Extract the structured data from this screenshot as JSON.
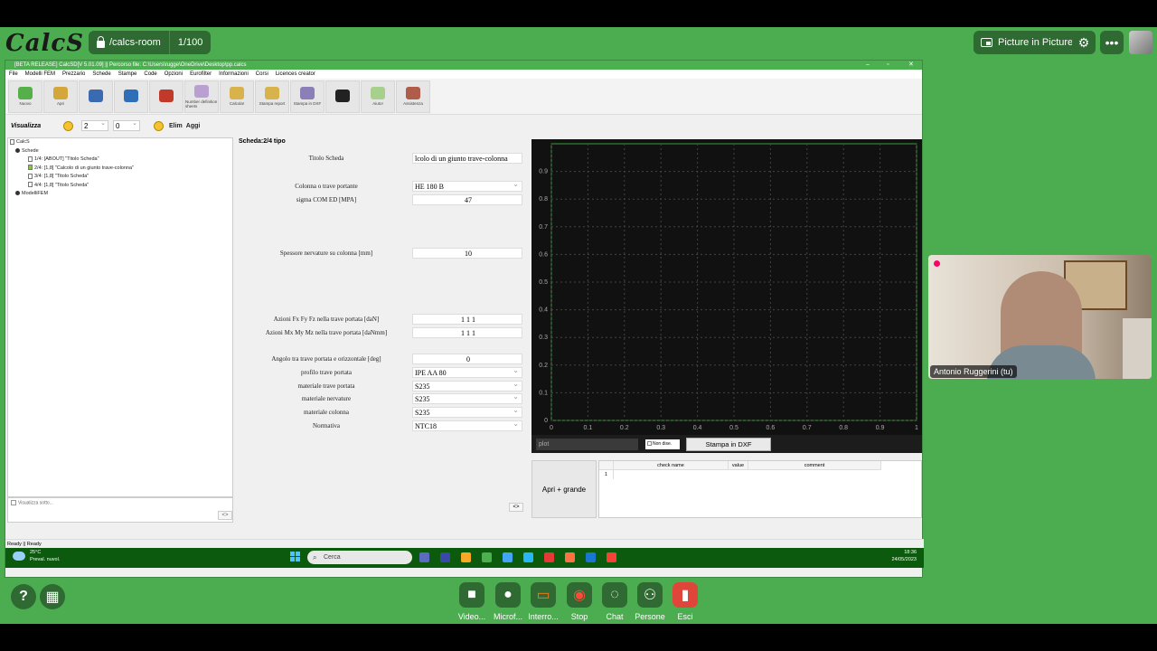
{
  "zoom": {
    "brand": "CalcS",
    "room": "/calcs-room",
    "page_counter": "1/100",
    "pip_label": "Picture in Picture",
    "participant_name": "Antonio Ruggerini (tu)",
    "bottom": [
      {
        "label": "Video..."
      },
      {
        "label": "Microf..."
      },
      {
        "label": "Interro..."
      },
      {
        "label": "Stop"
      },
      {
        "label": "Chat"
      },
      {
        "label": "Persone"
      },
      {
        "label": "Esci"
      }
    ]
  },
  "app": {
    "title": "[BETA RELEASE] CalcSD[V 5.01.09] || Percorso file: C:\\Users\\rugge\\OneDrive\\Desktop\\pp.calcs",
    "menu": [
      "File",
      "Modelli FEM",
      "Prezzario",
      "Schede",
      "Stampe",
      "Code",
      "Opzioni",
      "Eurofilter",
      "Informazioni",
      "Corsi",
      "Licences creator"
    ],
    "toolbar": [
      {
        "label": "Nuovo",
        "color": "#55b04a"
      },
      {
        "label": "Apri",
        "color": "#d4a73c"
      },
      {
        "label": "",
        "color": "#3a6ab0"
      },
      {
        "label": "",
        "color": "#2e6fb8"
      },
      {
        "label": "",
        "color": "#c0392b"
      },
      {
        "label": "Number definition sheets",
        "color": "#b9a0d0"
      },
      {
        "label": "Calcola!",
        "color": "#d8b24a"
      },
      {
        "label": "Stampa report",
        "color": "#d8b24a"
      },
      {
        "label": "Stampa in DXF",
        "color": "#8c7fb8"
      },
      {
        "label": "",
        "color": "#222"
      },
      {
        "label": "Aiuto!",
        "color": "#a8d08d"
      },
      {
        "label": "Assistenza",
        "color": "#b05c4a"
      }
    ],
    "viz": {
      "label": "Visualizza",
      "sel1": "2",
      "sel2": "0",
      "elim": "Elim",
      "aggi": "Aggi"
    },
    "tree": {
      "root": "CalcS",
      "schede": "Schede",
      "items": [
        "1/4: [ABOUT] \"Titolo Scheda\"",
        "2/4: [1,8] \"Calcolo di un giunto trave-colonna\"",
        "3/4: [1,8] \"Titolo Scheda\"",
        "4/4: [1,8] \"Titolo Scheda\""
      ],
      "fem": "ModelliFEM",
      "footer": "Visualizza sotto..."
    },
    "form": {
      "header": "Scheda:2/4 tipo",
      "titolo_label": "Titolo Scheda",
      "titolo_value": "lcolo di un giunto trave-colonna",
      "colonna_label": "Colonna o trave portante",
      "colonna_value": "HE 180 B",
      "sigma_label": "sigma COM ED [MPA]",
      "sigma_value": "47",
      "spessore_label": "Spessore nervature su colonna [mm]",
      "spessore_value": "10",
      "azioni_f_label": "Azioni Fx Fy Fz nella trave portata [daN]",
      "azioni_f_value": "1 1 1",
      "azioni_m_label": "Azioni Mx My Mz nella trave portata [daNmm]",
      "azioni_m_value": "1 1 1",
      "angolo_label": "Angolo tra trave portata e orizzontale [deg]",
      "angolo_value": "0",
      "profilo_label": "profilo trave portata",
      "profilo_value": "IPE AA 80",
      "mat_trave_label": "materiale trave portata",
      "mat_trave_value": "S235",
      "mat_nerv_label": "materiale nervature",
      "mat_nerv_value": "S235",
      "mat_col_label": "materiale colonna",
      "mat_col_value": "S235",
      "normativa_label": "Normativa",
      "normativa_value": "NTC18",
      "arrow": "<>"
    },
    "plot": {
      "xticks": [
        "0",
        "0.1",
        "0.2",
        "0.3",
        "0.4",
        "0.5",
        "0.6",
        "0.7",
        "0.8",
        "0.9",
        "1"
      ],
      "yticks": [
        "0",
        "0.1",
        "0.2",
        "0.3",
        "0.4",
        "0.5",
        "0.6",
        "0.7",
        "0.8",
        "0.9"
      ],
      "select_value": "plot",
      "checkbox_label": "Non dise.",
      "dxf_button": "Stampa in DXF"
    },
    "results": {
      "open_button": "Apri + grande",
      "cols": [
        "check name",
        "value",
        "comment"
      ],
      "row1": "1"
    },
    "status": "Ready || Ready",
    "taskbar": {
      "weather_temp": "25°C",
      "weather_desc": "Preval. nuvol.",
      "search": "Cerca",
      "time": "18:36",
      "date": "24/05/2023"
    }
  }
}
